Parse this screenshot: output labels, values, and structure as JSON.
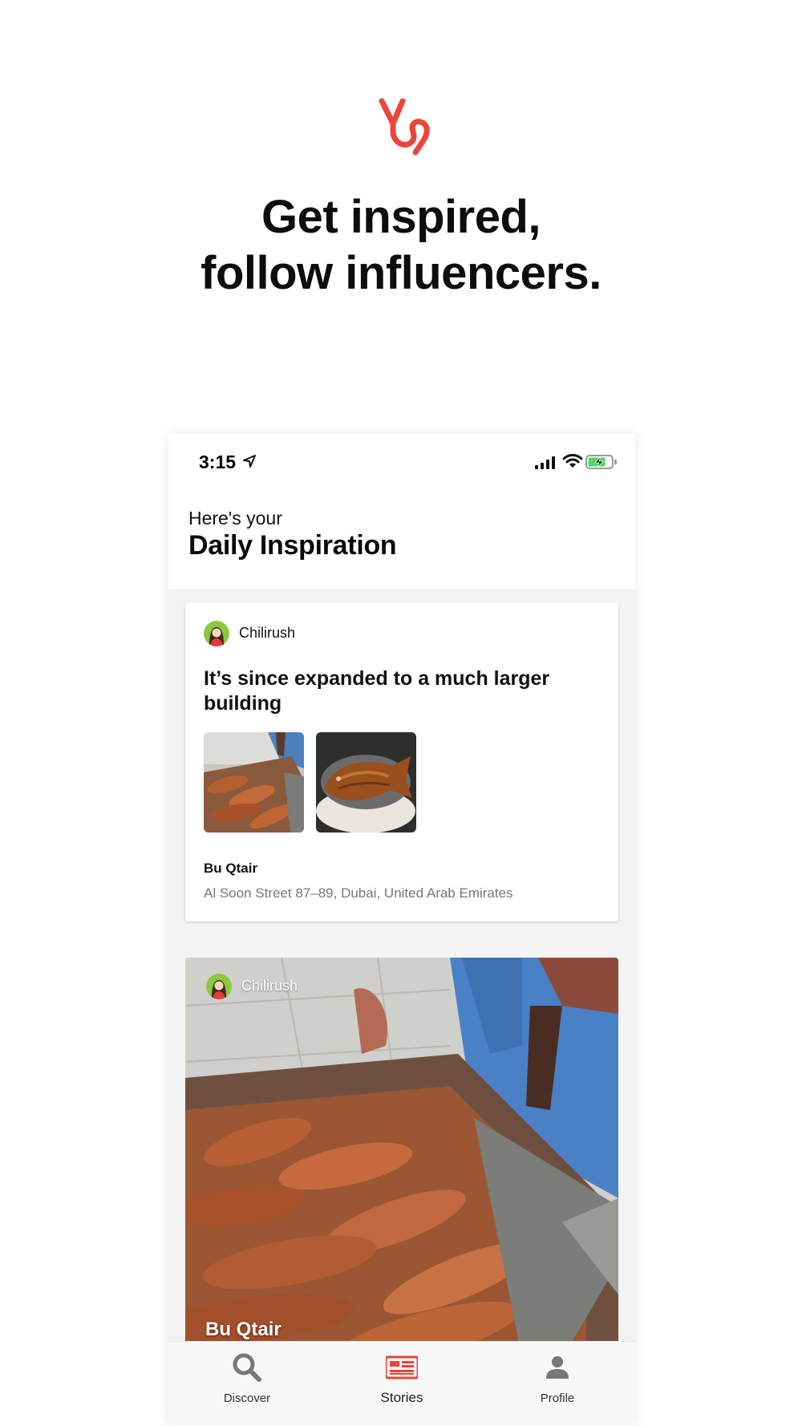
{
  "promo": {
    "headline_line1": "Get inspired,",
    "headline_line2": "follow influencers.",
    "logo_icon": "ys-logo-icon",
    "brand_color": "#f0443a"
  },
  "status_bar": {
    "time": "3:15",
    "icons": [
      "location-arrow-icon",
      "signal-icon",
      "wifi-icon",
      "battery-charging-icon"
    ]
  },
  "header": {
    "subtitle": "Here's your",
    "title": "Daily Inspiration"
  },
  "feed": [
    {
      "author": "Chilirush",
      "title": "It’s since expanded to a much larger building",
      "place_name": "Bu Qtair",
      "place_address": "Al Soon Street 87–89, Dubai, United Arab Emirates"
    },
    {
      "author": "Chilirush",
      "place_name": "Bu Qtair"
    }
  ],
  "tabs": [
    {
      "label": "Discover",
      "icon": "search-icon"
    },
    {
      "label": "Stories",
      "icon": "newspaper-icon",
      "active_color": "#e8453c"
    },
    {
      "label": "Profile",
      "icon": "person-icon"
    }
  ]
}
